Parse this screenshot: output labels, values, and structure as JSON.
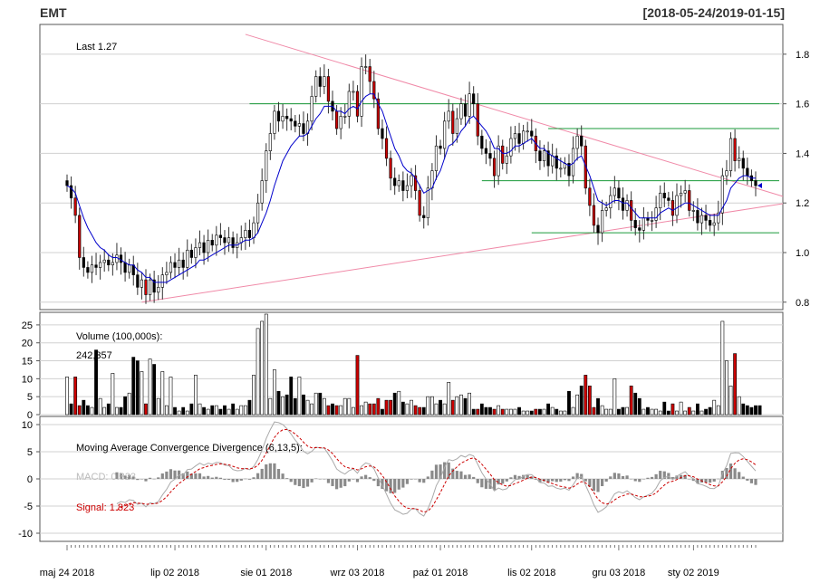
{
  "header": {
    "symbol": "EMT",
    "date_range": "[2018-05-24/2019-01-15]"
  },
  "chart_data": [
    {
      "type": "candlestick",
      "panel": "price",
      "annotation": "Last 1.27",
      "ylim": [
        0.77,
        1.92
      ],
      "y_ticks": [
        "0.8",
        "1.0",
        "1.2",
        "1.4",
        "1.6",
        "1.8"
      ],
      "y_tick_values": [
        0.8,
        1.0,
        1.2,
        1.4,
        1.6,
        1.8
      ],
      "grid": true,
      "x_tick_labels": [
        "maj 24 2018",
        "lip 02 2018",
        "sie 01 2018",
        "wrz 03 2018",
        "paź 01 2018",
        "lis 02 2018",
        "gru 03 2018",
        "sty 02 2019"
      ],
      "x_tick_bar_index": [
        0,
        26,
        48,
        70,
        90,
        112,
        133,
        151
      ],
      "bar_count": 163,
      "close": [
        1.27,
        1.22,
        1.15,
        0.98,
        0.94,
        0.92,
        0.95,
        0.94,
        0.96,
        0.97,
        0.95,
        0.96,
        0.99,
        0.96,
        0.92,
        0.95,
        0.91,
        0.86,
        0.89,
        0.83,
        0.89,
        0.84,
        0.86,
        0.91,
        0.92,
        0.96,
        0.94,
        0.97,
        0.94,
        1.01,
        0.98,
        1.02,
        1.04,
        1.0,
        1.05,
        1.03,
        1.07,
        1.06,
        1.04,
        1.06,
        1.02,
        1.04,
        1.06,
        1.09,
        1.06,
        1.12,
        1.2,
        1.29,
        1.41,
        1.48,
        1.57,
        1.53,
        1.55,
        1.54,
        1.53,
        1.51,
        1.52,
        1.48,
        1.53,
        1.63,
        1.71,
        1.67,
        1.71,
        1.61,
        1.57,
        1.5,
        1.55,
        1.55,
        1.65,
        1.65,
        1.55,
        1.75,
        1.75,
        1.69,
        1.62,
        1.5,
        1.46,
        1.38,
        1.3,
        1.27,
        1.29,
        1.25,
        1.27,
        1.31,
        1.25,
        1.15,
        1.14,
        1.26,
        1.33,
        1.43,
        1.42,
        1.53,
        1.57,
        1.48,
        1.54,
        1.6,
        1.55,
        1.64,
        1.6,
        1.47,
        1.42,
        1.4,
        1.38,
        1.31,
        1.43,
        1.36,
        1.39,
        1.46,
        1.48,
        1.44,
        1.49,
        1.49,
        1.47,
        1.41,
        1.37,
        1.41,
        1.35,
        1.39,
        1.34,
        1.34,
        1.36,
        1.31,
        1.42,
        1.47,
        1.43,
        1.26,
        1.19,
        1.11,
        1.08,
        1.17,
        1.18,
        1.23,
        1.26,
        1.22,
        1.17,
        1.21,
        1.13,
        1.1,
        1.09,
        1.14,
        1.13,
        1.13,
        1.18,
        1.24,
        1.22,
        1.21,
        1.15,
        1.23,
        1.24,
        1.25,
        1.17,
        1.17,
        1.12,
        1.15,
        1.13,
        1.11,
        1.12,
        1.16,
        1.31,
        1.33,
        1.46,
        1.37,
        1.38,
        1.34,
        1.31,
        1.29,
        1.27
      ],
      "moving_average": [
        1.27,
        1.26,
        1.24,
        1.19,
        1.14,
        1.1,
        1.07,
        1.04,
        1.02,
        1.01,
        0.99,
        0.98,
        0.98,
        0.97,
        0.96,
        0.95,
        0.95,
        0.93,
        0.92,
        0.9,
        0.9,
        0.88,
        0.88,
        0.88,
        0.88,
        0.89,
        0.9,
        0.91,
        0.92,
        0.93,
        0.94,
        0.95,
        0.97,
        0.97,
        0.98,
        0.99,
        1.0,
        1.01,
        1.02,
        1.03,
        1.03,
        1.03,
        1.04,
        1.05,
        1.05,
        1.06,
        1.08,
        1.12,
        1.16,
        1.21,
        1.27,
        1.32,
        1.37,
        1.4,
        1.43,
        1.45,
        1.47,
        1.47,
        1.48,
        1.51,
        1.54,
        1.56,
        1.59,
        1.59,
        1.59,
        1.57,
        1.57,
        1.56,
        1.58,
        1.59,
        1.58,
        1.61,
        1.63,
        1.64,
        1.64,
        1.6,
        1.57,
        1.52,
        1.47,
        1.42,
        1.39,
        1.35,
        1.33,
        1.32,
        1.3,
        1.27,
        1.24,
        1.25,
        1.26,
        1.3,
        1.33,
        1.38,
        1.43,
        1.44,
        1.46,
        1.49,
        1.51,
        1.54,
        1.55,
        1.53,
        1.51,
        1.49,
        1.46,
        1.42,
        1.42,
        1.4,
        1.4,
        1.41,
        1.43,
        1.43,
        1.44,
        1.45,
        1.46,
        1.44,
        1.42,
        1.42,
        1.4,
        1.39,
        1.38,
        1.37,
        1.36,
        1.35,
        1.36,
        1.38,
        1.39,
        1.35,
        1.31,
        1.26,
        1.21,
        1.2,
        1.19,
        1.2,
        1.21,
        1.21,
        1.2,
        1.2,
        1.18,
        1.16,
        1.14,
        1.14,
        1.14,
        1.14,
        1.14,
        1.16,
        1.17,
        1.18,
        1.17,
        1.18,
        1.19,
        1.2,
        1.2,
        1.19,
        1.18,
        1.17,
        1.16,
        1.15,
        1.15,
        1.15,
        1.18,
        1.21,
        1.26,
        1.28,
        1.3,
        1.31,
        1.31,
        1.3,
        1.3
      ],
      "up_down": "black bars = down, white bars = up, red = large move",
      "trend_lines": [
        {
          "from": [
            43,
            1.88
          ],
          "to": [
            162,
            1.28
          ],
          "color": "#f08aa8"
        },
        {
          "from": [
            18,
            0.8
          ],
          "to": [
            162,
            1.17
          ],
          "color": "#f08aa8"
        }
      ],
      "horizontal_levels": [
        {
          "y": 1.6,
          "from_bar": 44,
          "to_bar": 162,
          "color": "#1a9a3a"
        },
        {
          "y": 1.5,
          "from_bar": 116,
          "to_bar": 162,
          "color": "#1a9a3a"
        },
        {
          "y": 1.29,
          "from_bar": 100,
          "to_bar": 162,
          "color": "#1a9a3a"
        },
        {
          "y": 1.08,
          "from_bar": 112,
          "to_bar": 162,
          "color": "#1a9a3a"
        }
      ],
      "colors": {
        "ma": "#0000cc",
        "up_body": "#ffffff",
        "down_body": "#000000",
        "red_body": "#cc0000"
      }
    },
    {
      "type": "bar",
      "panel": "volume",
      "title": "Volume (100,000s):",
      "last_value": "242,357",
      "ylim": [
        0,
        28
      ],
      "y_ticks": [
        "0",
        "5",
        "10",
        "15",
        "20",
        "25"
      ],
      "y_tick_values": [
        0,
        5,
        10,
        15,
        20,
        25
      ],
      "values": [
        10.5,
        3,
        10.5,
        2.5,
        4,
        2.5,
        2,
        18,
        4.5,
        2,
        3,
        11.5,
        2,
        2,
        5,
        6,
        16,
        15,
        12,
        3,
        15.5,
        14,
        4.5,
        12,
        2.5,
        10.5,
        2,
        1,
        2,
        1,
        3,
        11,
        3,
        2,
        1.5,
        2.5,
        2.5,
        1.5,
        2.5,
        1.5,
        3,
        1.5,
        2.5,
        2.5,
        4,
        11,
        24,
        26,
        28,
        4.5,
        12.5,
        6.5,
        5,
        5.5,
        10.5,
        4.5,
        10.5,
        5.5,
        4,
        3,
        6,
        6,
        4.5,
        2.5,
        3,
        2.5,
        2.5,
        4.5,
        4.5,
        2,
        16.5,
        2.5,
        3.5,
        3,
        3,
        4.5,
        1.5,
        4,
        4,
        6,
        6.5,
        3.5,
        3,
        4,
        2.5,
        2,
        2,
        5,
        5,
        3,
        4,
        3,
        9,
        4,
        5,
        5.5,
        4.5,
        6,
        1.5,
        1.5,
        3,
        2,
        2,
        1.5,
        2.5,
        1.5,
        1.5,
        1.5,
        1.5,
        2,
        1,
        1,
        1,
        1.5,
        1.5,
        1.5,
        3,
        2,
        1.5,
        1,
        1,
        6.5,
        2,
        5.5,
        8,
        11,
        8,
        2,
        4.5,
        2.5,
        1.5,
        1.5,
        10,
        1.5,
        2,
        2,
        8,
        6,
        4.5,
        1.5,
        2,
        1.5,
        1.5,
        1,
        3.5,
        1,
        3,
        1,
        3.5,
        1,
        2,
        1,
        3,
        1,
        1.5,
        2,
        4,
        2.5,
        26,
        15,
        8,
        17,
        5,
        3,
        2.5,
        2,
        2.5,
        2.5
      ],
      "grid": true
    },
    {
      "type": "line",
      "panel": "macd",
      "title": "Moving Average Convergence Divergence (6,13,5):",
      "series": [
        {
          "name": "MACD: 0.823",
          "color": "#aaaaaa"
        },
        {
          "name": "Signal: 1.823",
          "color": "#cc0000"
        }
      ],
      "ylim": [
        -11.5,
        11.5
      ],
      "y_ticks": [
        "-10",
        "-5",
        "0",
        "5",
        "10"
      ],
      "y_tick_values": [
        -10,
        -5,
        0,
        5,
        10
      ],
      "grid": true
    }
  ]
}
